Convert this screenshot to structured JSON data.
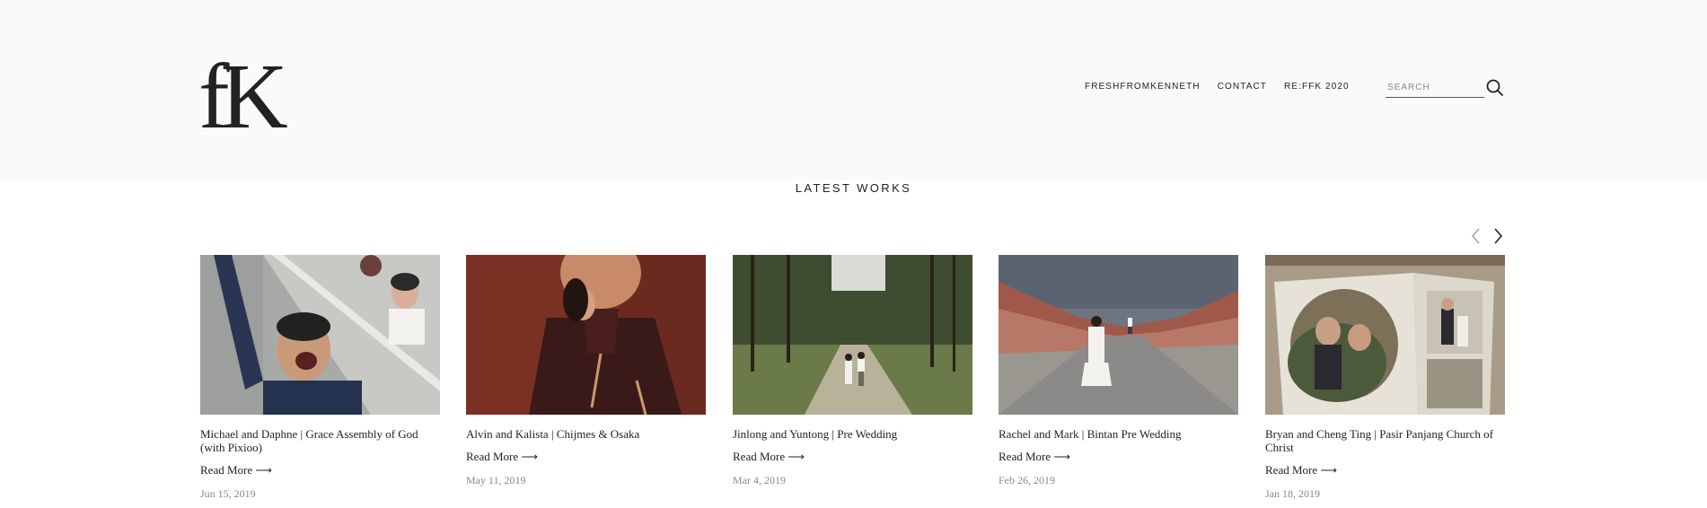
{
  "brand": {
    "logo_text": "fK"
  },
  "nav": {
    "items": [
      "FRESHFROMKENNETH",
      "CONTACT",
      "RE:FFK 2020"
    ]
  },
  "search": {
    "placeholder": "SEARCH",
    "value": ""
  },
  "section": {
    "title": "LATEST WORKS"
  },
  "carousel": {
    "prev_icon": "chevron-left-icon",
    "next_icon": "chevron-right-icon",
    "read_more_label": "Read More ⟶",
    "cards": [
      {
        "title": "Michael and Daphne | Grace Assembly of God (with Pixioo)",
        "date": "Jun 15, 2019",
        "image": "wedding-stairs-photo"
      },
      {
        "title": "Alvin and Kalista | Chijmes & Osaka",
        "date": "May 11, 2019",
        "image": "couple-red-wall-photo"
      },
      {
        "title": "Jinlong and Yuntong | Pre Wedding",
        "date": "Mar 4, 2019",
        "image": "forest-path-photo"
      },
      {
        "title": "Rachel and Mark | Bintan Pre Wedding",
        "date": "Feb 26, 2019",
        "image": "red-hills-road-photo"
      },
      {
        "title": "Bryan and Cheng Ting | Pasir Panjang Church of Christ",
        "date": "Jan 18, 2019",
        "image": "photo-album-photo"
      }
    ]
  },
  "colors": {
    "header_bg": "#fafafa",
    "text": "#222222",
    "date": "#888888"
  }
}
